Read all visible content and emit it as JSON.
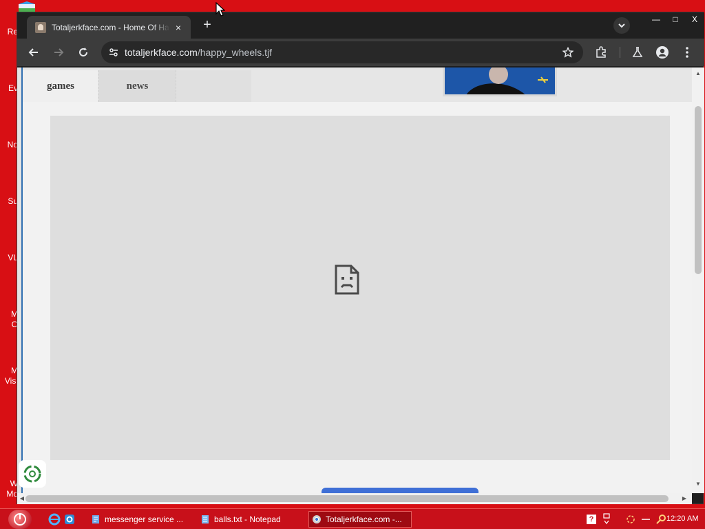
{
  "desktop": {
    "icon_labels": [
      "Re",
      "Ev",
      "No",
      "Su",
      "VL",
      "M",
      "O",
      "M",
      "Visi",
      "W",
      "Mo"
    ]
  },
  "browser": {
    "tab": {
      "title": "Totaljerkface.com - Home Of Happy Wheels",
      "close_glyph": "×"
    },
    "new_tab_glyph": "+",
    "window_controls": {
      "minimize": "—",
      "maximize": "□",
      "close": "X"
    },
    "url": {
      "host": "totaljerkface.com",
      "path": "/happy_wheels.tjf"
    }
  },
  "page": {
    "nav": {
      "games": "games",
      "news": "news"
    },
    "error_icon": "sad-file-icon"
  },
  "taskbar": {
    "items": [
      {
        "label": "messenger service ...",
        "icon": "document-icon",
        "active": false
      },
      {
        "label": "balls.txt - Notepad",
        "icon": "notepad-icon",
        "active": false
      },
      {
        "label": "Totaljerkface.com -...",
        "icon": "chrome-icon",
        "active": true
      }
    ],
    "clock": "12:20 AM"
  },
  "colors": {
    "desktop": "#d80f14",
    "taskbar": "#c8101a",
    "accent_blue": "#3f6fd6"
  }
}
